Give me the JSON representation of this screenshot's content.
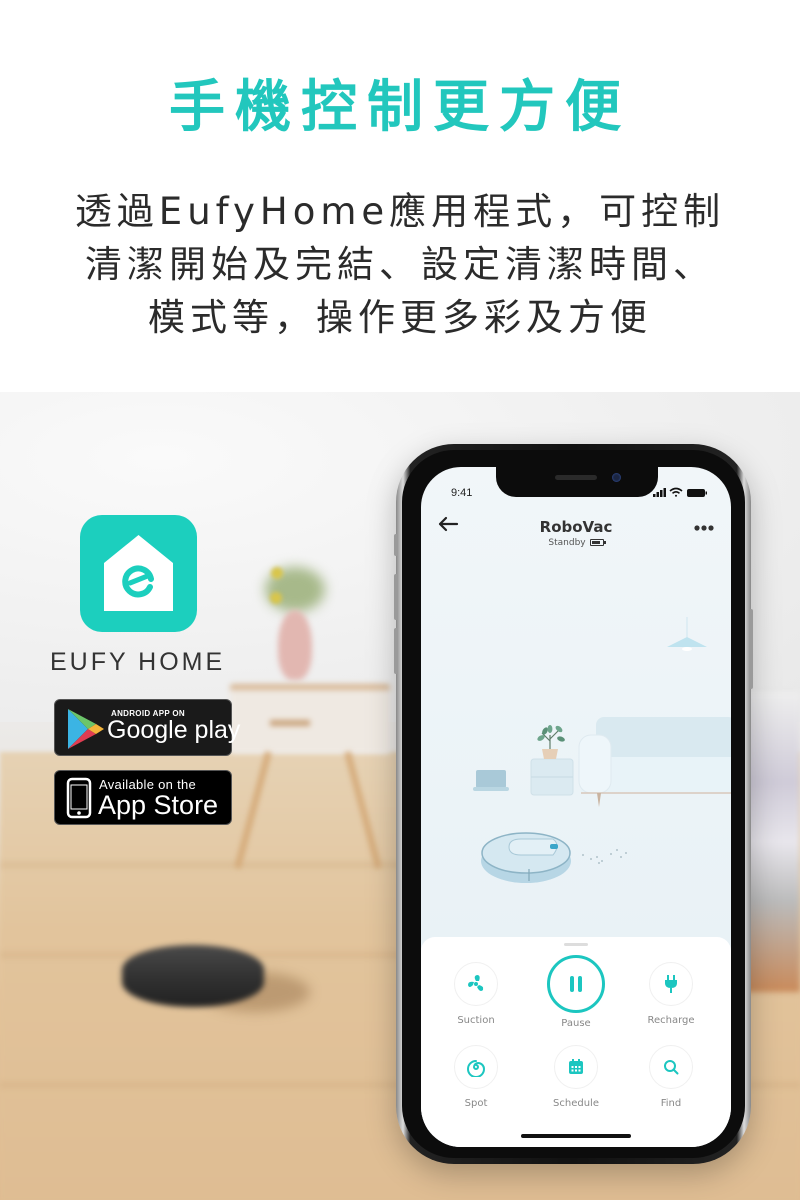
{
  "headline": "手機控制更方便",
  "description_lines": [
    "透過EufyHome應用程式，可控制",
    "清潔開始及完結、設定清潔時間、",
    "模式等，操作更多彩及方便"
  ],
  "app": {
    "name": "EUFY HOME",
    "icon": "eufy-home-house-icon",
    "brand_color": "#1ccfbe"
  },
  "store_badges": {
    "google_play": {
      "small": "ANDROID APP ON",
      "big": "Google play",
      "icon": "google-play-triangle-icon"
    },
    "app_store": {
      "small": "Available on the",
      "big": "App Store",
      "icon": "iphone-icon"
    }
  },
  "phone": {
    "status_bar": {
      "time": "9:41",
      "icons": [
        "signal-icon",
        "wifi-icon",
        "battery-icon"
      ]
    },
    "nav": {
      "back_icon": "arrow-left-icon",
      "title": "RoboVac",
      "status": "Standby",
      "more_icon": "more-dots-icon"
    },
    "controls": [
      {
        "label": "Suction",
        "icon": "fan-icon",
        "primary": false
      },
      {
        "label": "Pause",
        "icon": "pause-icon",
        "primary": true
      },
      {
        "label": "Recharge",
        "icon": "plug-icon",
        "primary": false
      },
      {
        "label": "Spot",
        "icon": "spiral-icon",
        "primary": false
      },
      {
        "label": "Schedule",
        "icon": "calendar-icon",
        "primary": false
      },
      {
        "label": "Find",
        "icon": "search-icon",
        "primary": false
      }
    ],
    "accent_color": "#1cc6c0"
  }
}
